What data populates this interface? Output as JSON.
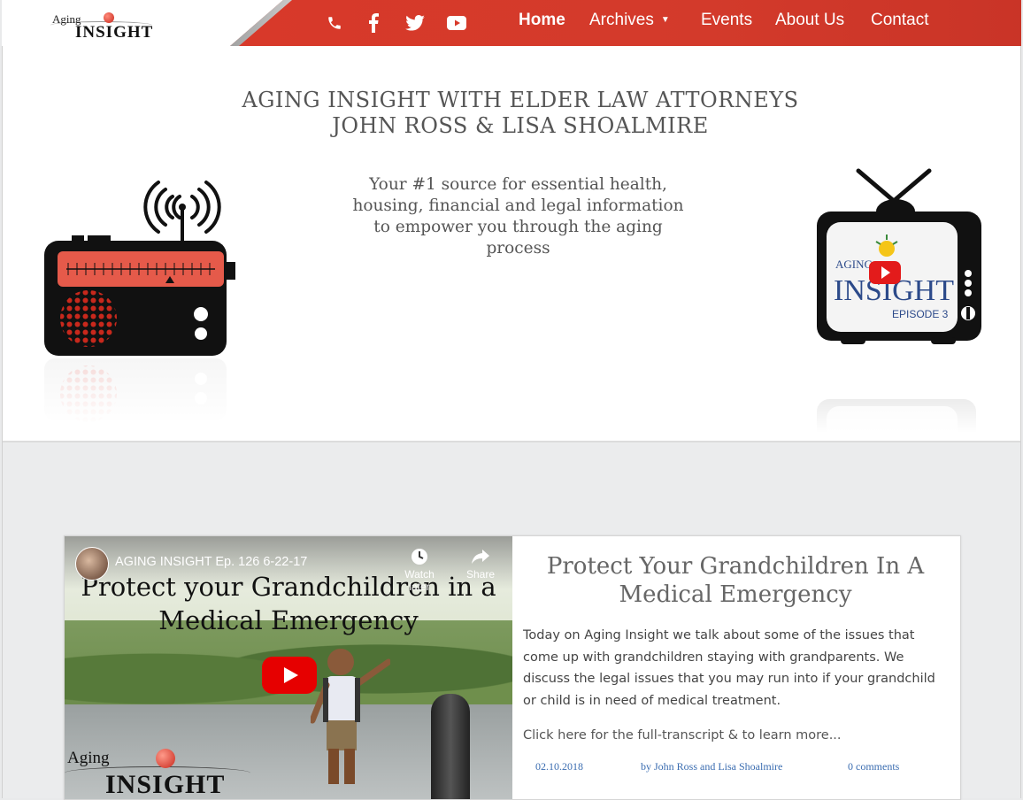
{
  "header": {
    "logo": {
      "aging": "Aging",
      "insight": "INSIGHT"
    },
    "social": [
      "phone-icon",
      "facebook-icon",
      "twitter-icon",
      "youtube-icon"
    ],
    "nav": [
      {
        "label": "Home"
      },
      {
        "label": "Archives"
      },
      {
        "label": "Events"
      },
      {
        "label": "About Us"
      },
      {
        "label": "Contact"
      }
    ]
  },
  "hero": {
    "title_line1": "AGING INSIGHT WITH ELDER LAW ATTORNEYS",
    "title_line2": "JOHN ROSS & LISA SHOALMIRE",
    "subtitle": "Your #1 source for essential health, housing, financial and legal information to empower you through the aging process",
    "tv_logo": {
      "aging": "AGING",
      "insight": "INSIGHT",
      "episode": "EPISODE 3"
    }
  },
  "post": {
    "video": {
      "channel_title": "AGING INSIGHT Ep. 126 6-22-17",
      "headline": "Protect your Grandchildren in a Medical Emergency",
      "watch_later": "Watch later",
      "share": "Share",
      "logo_aging": "Aging",
      "logo_insight": "INSIGHT"
    },
    "title": "Protect Your Grandchildren In A Medical Emergency",
    "body": "Today on Aging Insight we talk about some of the issues that come up with grandchildren staying with grandparents. We discuss the legal issues that you may run into if your grandchild or child is in need of medical treatment.",
    "more": "Click here for the full-transcript & to learn more...",
    "date": "02.10.2018",
    "author": "by John Ross and Lisa Shoalmire",
    "comments": "0 comments"
  },
  "colors": {
    "header_red": "#d8392a",
    "link_blue": "#3a6cb0",
    "title_gray": "#555555"
  }
}
